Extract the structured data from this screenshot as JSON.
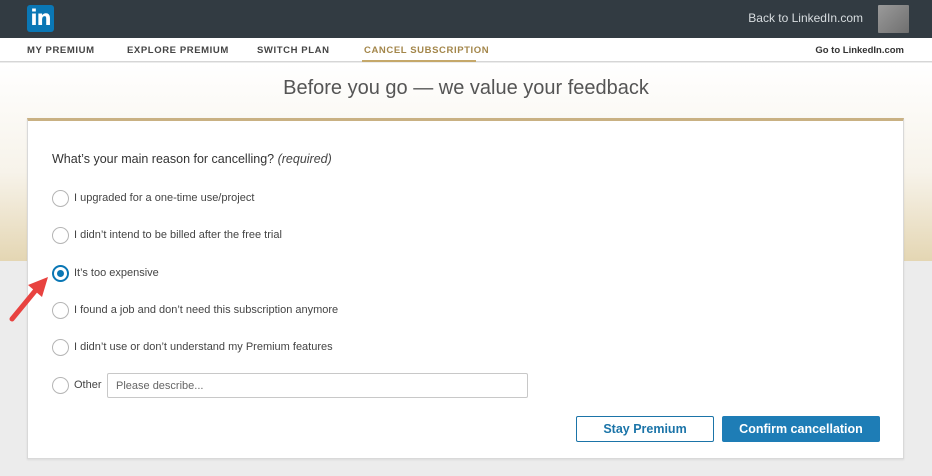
{
  "topbar": {
    "logo_text": "in",
    "back_link": "Back to LinkedIn.com"
  },
  "nav": {
    "items": [
      {
        "label": "MY PREMIUM"
      },
      {
        "label": "EXPLORE PREMIUM"
      },
      {
        "label": "SWITCH PLAN"
      },
      {
        "label": "CANCEL SUBSCRIPTION"
      }
    ],
    "active": "CANCEL SUBSCRIPTION",
    "goto_link": "Go to LinkedIn.com"
  },
  "page_title": "Before you go — we value your feedback",
  "form": {
    "question": "What’s your main reason for cancelling?",
    "required": "(required)",
    "options": [
      {
        "label": "I upgraded for a one-time use/project",
        "checked": false
      },
      {
        "label": "I didn’t intend to be billed after the free trial",
        "checked": false
      },
      {
        "label": "It’s too expensive",
        "checked": true
      },
      {
        "label": "I found a job and don’t need this subscription anymore",
        "checked": false
      },
      {
        "label": "I didn’t use or don’t understand my Premium features",
        "checked": false
      },
      {
        "label": "Other",
        "checked": false
      }
    ],
    "other_placeholder": "Please describe..."
  },
  "buttons": {
    "stay": "Stay Premium",
    "confirm": "Confirm cancellation"
  },
  "colors": {
    "topbar": "#323b42",
    "brand_blue": "#0a77b5",
    "accent_gold": "#c5a86a",
    "annotation_arrow": "#e8423f"
  }
}
